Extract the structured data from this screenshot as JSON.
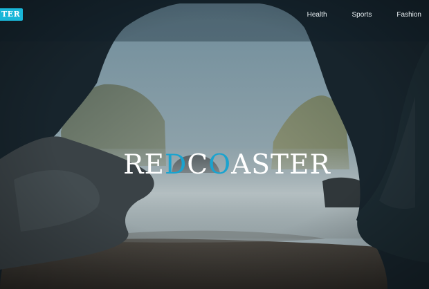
{
  "header": {
    "logo_text": "TER",
    "nav": [
      "Health",
      "Sports",
      "Fashion"
    ]
  },
  "hero": {
    "brand_parts": [
      "RE",
      "D",
      "C",
      "O",
      "ASTER"
    ],
    "accent_color": "#1aa3cf",
    "scene": "sea-cave-with-foggy-beach"
  },
  "colors": {
    "logo_badge": "#19b6d8",
    "nav_text": "#e9f0f3",
    "brand_text": "#ffffff"
  }
}
